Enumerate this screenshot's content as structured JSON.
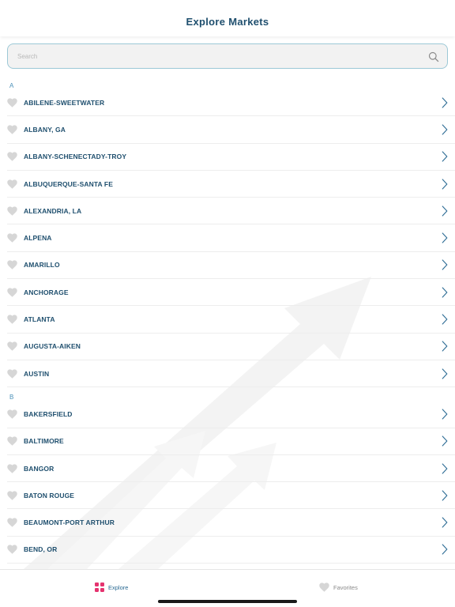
{
  "header": {
    "title": "Explore Markets"
  },
  "search": {
    "placeholder": "Search"
  },
  "sections": [
    {
      "letter": "A",
      "items": [
        "ABILENE-SWEETWATER",
        "ALBANY, GA",
        "ALBANY-SCHENECTADY-TROY",
        "ALBUQUERQUE-SANTA FE",
        "ALEXANDRIA, LA",
        "ALPENA",
        "AMARILLO",
        "ANCHORAGE",
        "ATLANTA",
        "AUGUSTA-AIKEN",
        "AUSTIN"
      ]
    },
    {
      "letter": "B",
      "items": [
        "BAKERSFIELD",
        "BALTIMORE",
        "BANGOR",
        "BATON ROUGE",
        "BEAUMONT-PORT ARTHUR",
        "BEND, OR"
      ]
    }
  ],
  "tabs": {
    "explore": {
      "label": "Explore",
      "icon": "grid-icon"
    },
    "favorites": {
      "label": "Favorites",
      "icon": "heart-icon"
    }
  },
  "colors": {
    "accent": "#1f4f6e",
    "section_letter": "#4a90b8",
    "explore_icon": "#e5336f",
    "heart_inactive": "#d6d6d6",
    "search_border": "#9cc8d6"
  }
}
